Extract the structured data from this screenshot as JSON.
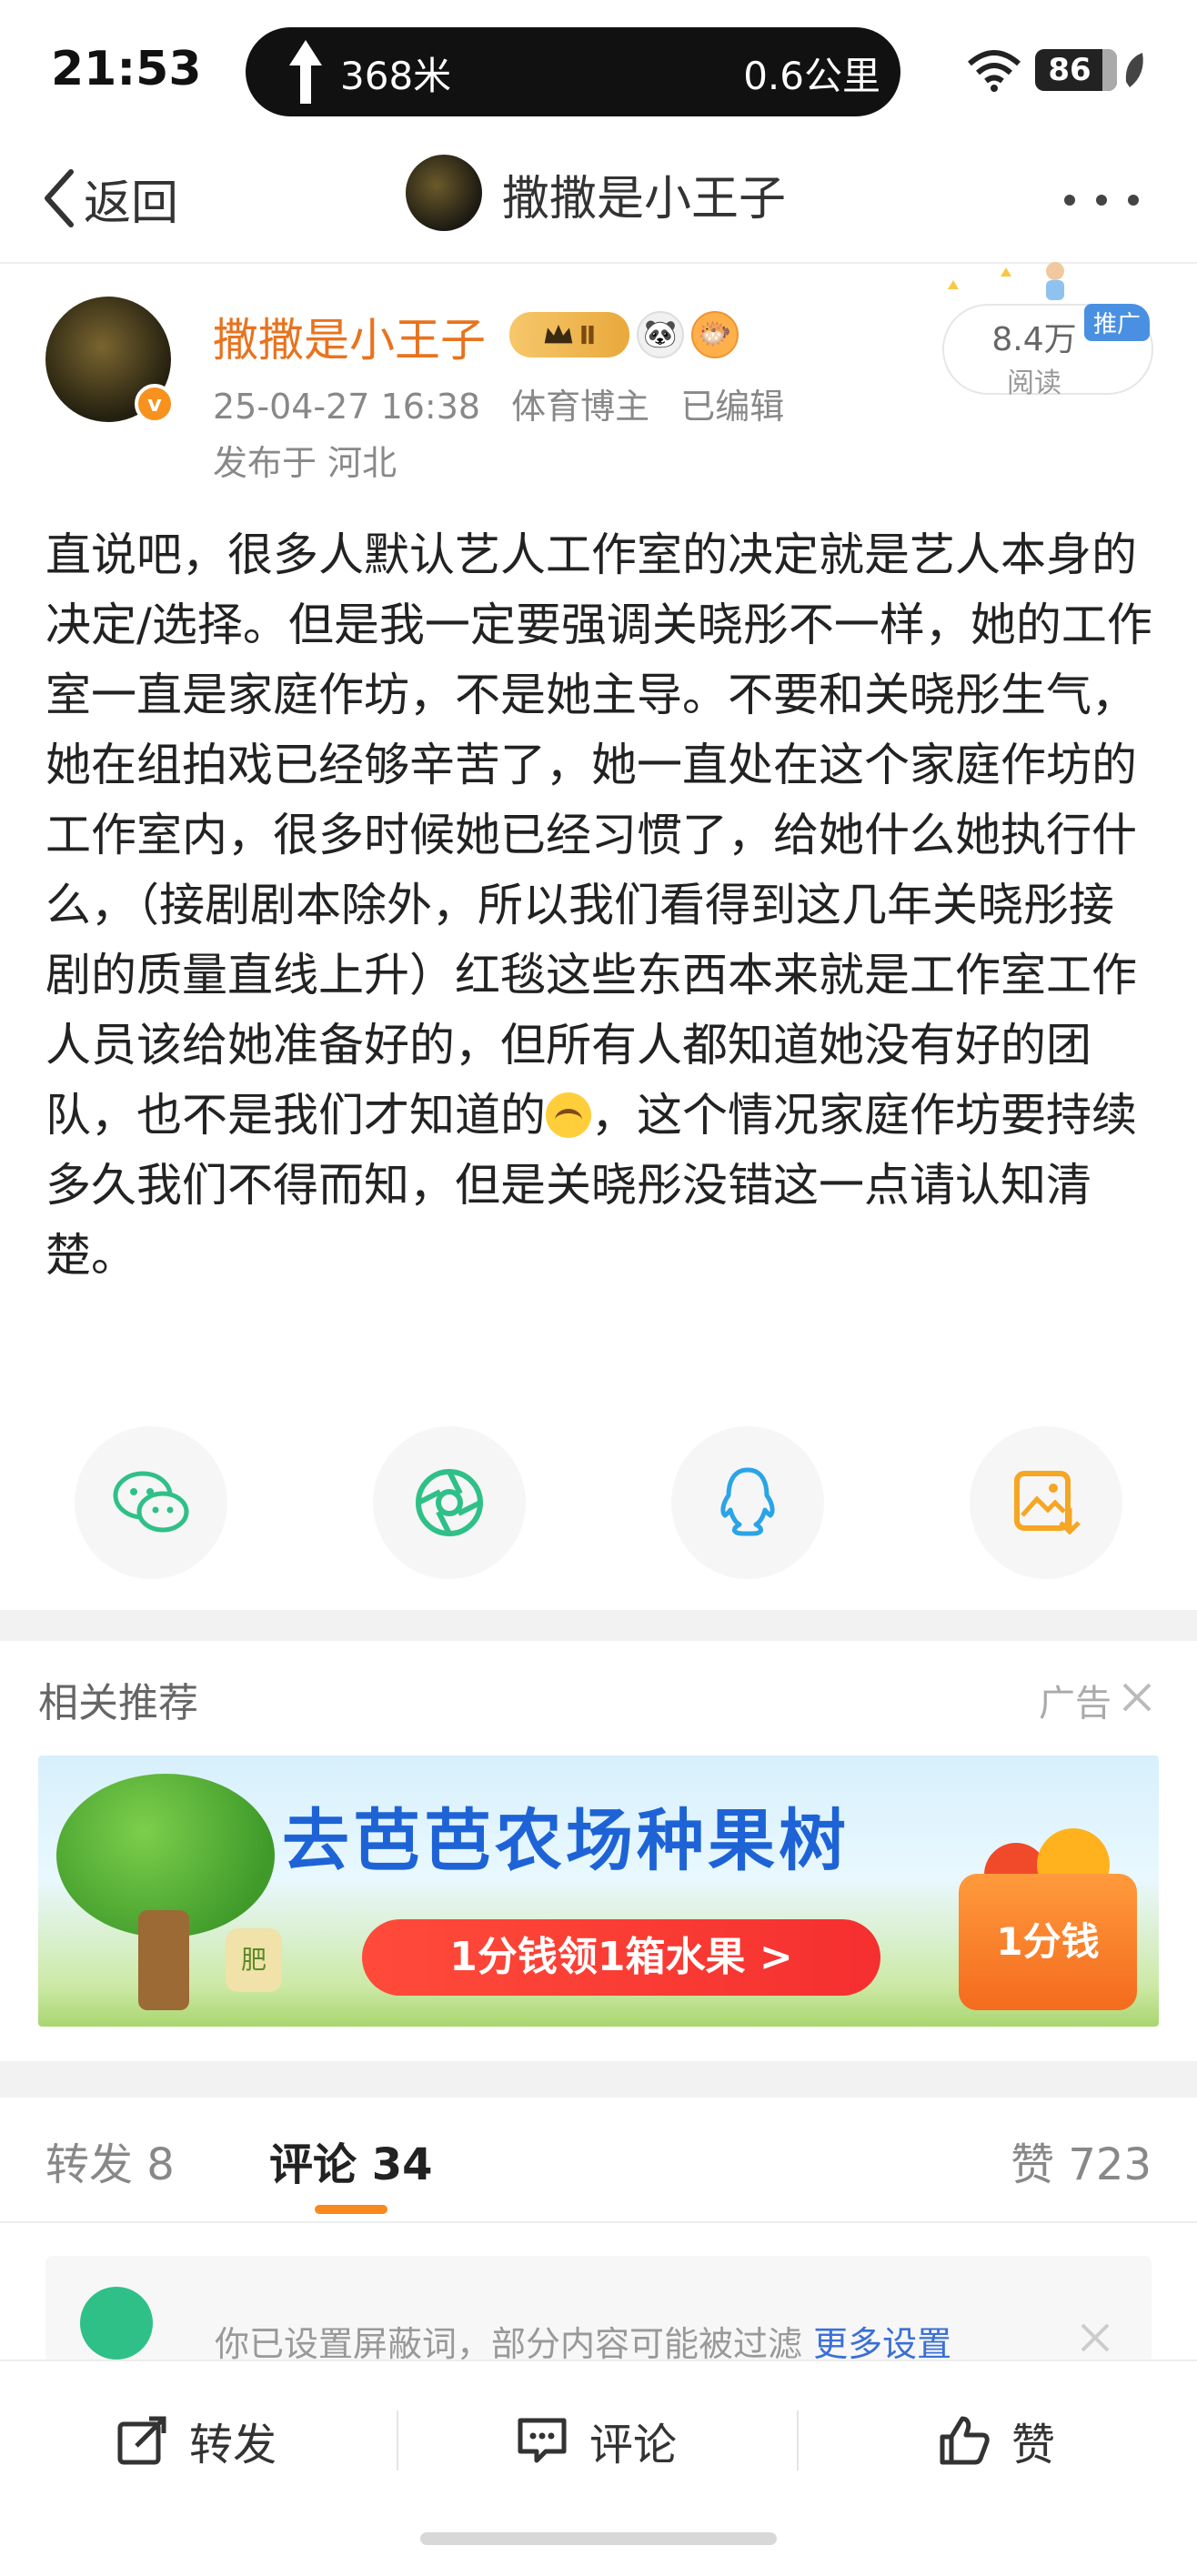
{
  "status_bar": {
    "time": "21:53",
    "nav_distance_1": "368米",
    "nav_distance_2": "0.6公里",
    "battery": "86"
  },
  "header": {
    "back_label": "返回",
    "title": "撒撒是小王子"
  },
  "post": {
    "author": "撒撒是小王子",
    "level_badge": "Ⅱ",
    "timestamp": "25-04-27 16:38",
    "category": "体育博主",
    "edited": "已编辑",
    "location": "发布于 河北",
    "reads": "8.4万",
    "reads_label": "阅读",
    "promo_label": "推广",
    "body_before_emoji": "直说吧，很多人默认艺人工作室的决定就是艺人本身的决定/选择。但是我一定要强调关晓彤不一样，她的工作室一直是家庭作坊，不是她主导。不要和关晓彤生气，她在组拍戏已经够辛苦了，她一直处在这个家庭作坊的工作室内，很多时候她已经习惯了，给她什么她执行什么，（接剧剧本除外，所以我们看得到这几年关晓彤接剧的质量直线上升）红毯这些东西本来就是工作室工作人员该给她准备好的，但所有人都知道她没有好的团队，也不是我们才知道的",
    "body_after_emoji": "，这个情况家庭作坊要持续多久我们不得而知，但是关晓彤没错这一点请认知清楚。"
  },
  "share_icons": [
    "wechat-icon",
    "moments-icon",
    "qq-icon",
    "save-image-icon"
  ],
  "recommend": {
    "title": "相关推荐",
    "ad_label": "广告",
    "banner_headline": "去芭芭农场种果树",
    "banner_cta": "1分钱领1箱水果 >",
    "banner_box": "1分钱",
    "banner_bag": "肥"
  },
  "tabs": {
    "repost": "转发 8",
    "comment": "评论 34",
    "like": "赞 723"
  },
  "notice": {
    "text": "你已设置屏蔽词，部分内容可能被过滤",
    "link": "更多设置"
  },
  "bottom_bar": {
    "repost": "转发",
    "comment": "评论",
    "like": "赞"
  },
  "colors": {
    "accent_orange": "#f7891f",
    "author_orange": "#e8731f",
    "link_blue": "#3b6fd6",
    "wechat_green": "#2fc088",
    "qq_blue": "#2aa4e8",
    "save_orange": "#f5a623"
  }
}
